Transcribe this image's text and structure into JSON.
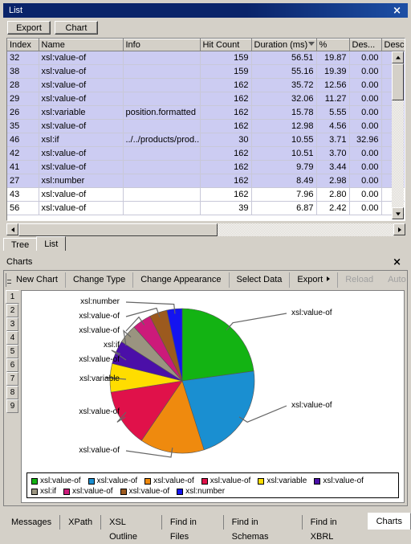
{
  "list_panel": {
    "title": "List",
    "close_icon": "×",
    "toolbar": {
      "export_label": "Export",
      "chart_label": "Chart"
    },
    "columns": [
      "Index",
      "Name",
      "Info",
      "Hit Count",
      "Duration (ms)",
      "%",
      "Des...",
      "Descenc"
    ],
    "sort_column": "Duration (ms)",
    "sort_direction": "descending",
    "rows": [
      {
        "index": "32",
        "name": "xsl:value-of",
        "info": "",
        "hits": "159",
        "duration": "56.51",
        "pct": "19.87",
        "des": "0.00",
        "descenc": "",
        "selected": true
      },
      {
        "index": "38",
        "name": "xsl:value-of",
        "info": "",
        "hits": "159",
        "duration": "55.16",
        "pct": "19.39",
        "des": "0.00",
        "descenc": "",
        "selected": true
      },
      {
        "index": "28",
        "name": "xsl:value-of",
        "info": "",
        "hits": "162",
        "duration": "35.72",
        "pct": "12.56",
        "des": "0.00",
        "descenc": "",
        "selected": true
      },
      {
        "index": "29",
        "name": "xsl:value-of",
        "info": "",
        "hits": "162",
        "duration": "32.06",
        "pct": "11.27",
        "des": "0.00",
        "descenc": "",
        "selected": true
      },
      {
        "index": "26",
        "name": "xsl:variable",
        "info": "position.formatted",
        "hits": "162",
        "duration": "15.78",
        "pct": "5.55",
        "des": "0.00",
        "descenc": "",
        "selected": true
      },
      {
        "index": "35",
        "name": "xsl:value-of",
        "info": "",
        "hits": "162",
        "duration": "12.98",
        "pct": "4.56",
        "des": "0.00",
        "descenc": "",
        "selected": true
      },
      {
        "index": "46",
        "name": "xsl:if",
        "info": "../../products/prod...",
        "hits": "30",
        "duration": "10.55",
        "pct": "3.71",
        "des": "32.96",
        "descenc": "",
        "selected": true
      },
      {
        "index": "42",
        "name": "xsl:value-of",
        "info": "",
        "hits": "162",
        "duration": "10.51",
        "pct": "3.70",
        "des": "0.00",
        "descenc": "",
        "selected": true
      },
      {
        "index": "41",
        "name": "xsl:value-of",
        "info": "",
        "hits": "162",
        "duration": "9.79",
        "pct": "3.44",
        "des": "0.00",
        "descenc": "",
        "selected": true
      },
      {
        "index": "27",
        "name": "xsl:number",
        "info": "",
        "hits": "162",
        "duration": "8.49",
        "pct": "2.98",
        "des": "0.00",
        "descenc": "",
        "selected": true
      },
      {
        "index": "43",
        "name": "xsl:value-of",
        "info": "",
        "hits": "162",
        "duration": "7.96",
        "pct": "2.80",
        "des": "0.00",
        "descenc": "",
        "selected": false
      },
      {
        "index": "56",
        "name": "xsl:value-of",
        "info": "",
        "hits": "39",
        "duration": "6.87",
        "pct": "2.42",
        "des": "0.00",
        "descenc": "",
        "selected": false
      }
    ],
    "view_tabs": [
      {
        "label": "Tree",
        "active": false
      },
      {
        "label": "List",
        "active": true
      }
    ]
  },
  "charts_panel": {
    "title": "Charts",
    "close_icon": "×",
    "toolbar": {
      "new_chart": "New Chart",
      "change_type": "Change Type",
      "change_appearance": "Change Appearance",
      "select_data": "Select Data",
      "export": "Export",
      "export_arrow": "▶",
      "reload": "Reload",
      "auto": "Auto"
    },
    "chart_tabs": [
      {
        "label": "1",
        "active": true
      },
      {
        "label": "2",
        "active": false
      },
      {
        "label": "3",
        "active": false
      },
      {
        "label": "4",
        "active": false
      },
      {
        "label": "5",
        "active": false
      },
      {
        "label": "6",
        "active": false
      },
      {
        "label": "7",
        "active": false
      },
      {
        "label": "8",
        "active": false
      },
      {
        "label": "9",
        "active": false
      }
    ]
  },
  "chart_data": {
    "type": "pie",
    "title": "",
    "legend_position": "bottom",
    "labels_shown": true,
    "categories": [
      "xsl:value-of",
      "xsl:value-of",
      "xsl:value-of",
      "xsl:value-of",
      "xsl:variable",
      "xsl:value-of",
      "xsl:if",
      "xsl:value-of",
      "xsl:value-of",
      "xsl:number"
    ],
    "values": [
      19.87,
      19.39,
      12.56,
      11.27,
      5.55,
      4.56,
      3.71,
      3.7,
      3.44,
      2.98
    ],
    "colors": [
      "#13b313",
      "#1a8fd1",
      "#ef8a0e",
      "#e0114a",
      "#ffdd00",
      "#4b0fa8",
      "#9a9480",
      "#cc1a7a",
      "#9c5a1e",
      "#1414f0"
    ],
    "callout_labels": [
      {
        "text": "xsl:value-of",
        "side": "right"
      },
      {
        "text": "xsl:value-of",
        "side": "right"
      },
      {
        "text": "xsl:value-of",
        "side": "left"
      },
      {
        "text": "xsl:value-of",
        "side": "left"
      },
      {
        "text": "xsl:variable",
        "side": "left"
      },
      {
        "text": "xsl:value-of",
        "side": "left"
      },
      {
        "text": "xsl:if",
        "side": "left"
      },
      {
        "text": "xsl:value-of",
        "side": "left"
      },
      {
        "text": "xsl:value-of",
        "side": "left"
      },
      {
        "text": "xsl:number",
        "side": "left"
      }
    ],
    "legend_entries": [
      {
        "label": "xsl:value-of",
        "color": "#13b313"
      },
      {
        "label": "xsl:value-of",
        "color": "#1a8fd1"
      },
      {
        "label": "xsl:value-of",
        "color": "#ef8a0e"
      },
      {
        "label": "xsl:value-of",
        "color": "#e0114a"
      },
      {
        "label": "xsl:variable",
        "color": "#ffdd00"
      },
      {
        "label": "xsl:value-of",
        "color": "#4b0fa8"
      },
      {
        "label": "xsl:if",
        "color": "#9a9480"
      },
      {
        "label": "xsl:value-of",
        "color": "#cc1a7a"
      },
      {
        "label": "xsl:value-of",
        "color": "#9c5a1e"
      },
      {
        "label": "xsl:number",
        "color": "#1414f0"
      }
    ]
  },
  "bottom_tabs": [
    {
      "label": "Messages",
      "active": false
    },
    {
      "label": "XPath",
      "active": false
    },
    {
      "label": "XSL Outline",
      "active": false
    },
    {
      "label": "Find in Files",
      "active": false
    },
    {
      "label": "Find in Schemas",
      "active": false
    },
    {
      "label": "Find in XBRL",
      "active": false
    },
    {
      "label": "Charts",
      "active": true
    }
  ]
}
